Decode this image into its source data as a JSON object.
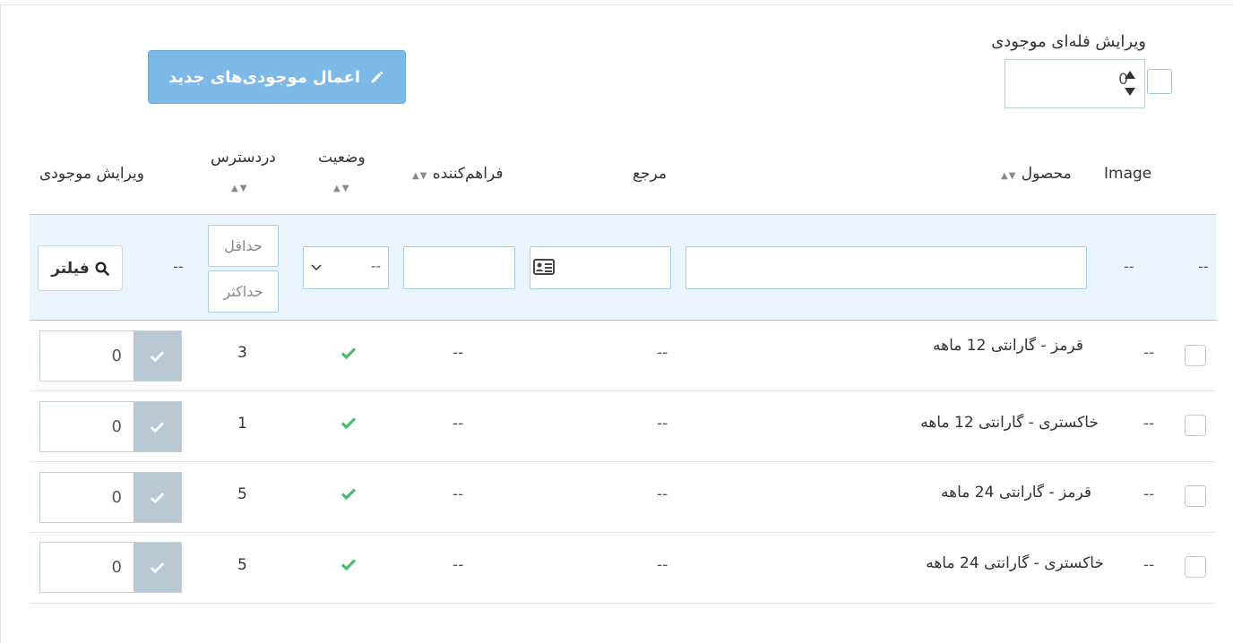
{
  "bulk": {
    "label": "ویرایش فله‌ای موجودی",
    "value": "0",
    "apply_label": "اعمال موجودی‌های جدید"
  },
  "columns": {
    "image": "Image",
    "product": "محصول",
    "reference": "مرجع",
    "supplier": "فراهم‌کننده",
    "status": "وضعیت",
    "available": "دردسترس",
    "edit_quantity": "ویرایش موجودی",
    "sort_arrows": "▲▼"
  },
  "filters": {
    "empty": "--",
    "status_select": "--",
    "min_placeholder": "حداقل",
    "max_placeholder": "حداکثر",
    "filter_button": "فیلتر"
  },
  "rows": [
    {
      "image": "--",
      "product": "قرمز - گارانتی 12 ماهه",
      "reference": "--",
      "supplier": "--",
      "available": "3",
      "edit_value": "0"
    },
    {
      "image": "--",
      "product": "خاکستری - گارانتی 12 ماهه",
      "reference": "--",
      "supplier": "--",
      "available": "1",
      "edit_value": "0"
    },
    {
      "image": "--",
      "product": "قرمز - گارانتی 24 ماهه",
      "reference": "--",
      "supplier": "--",
      "available": "5",
      "edit_value": "0"
    },
    {
      "image": "--",
      "product": "خاکستری - گارانتی 24 ماهه",
      "reference": "--",
      "supplier": "--",
      "available": "5",
      "edit_value": "0"
    }
  ],
  "colors": {
    "apply_button": "#7cb9e6",
    "filter_row": "#eaf4fb",
    "status_ok": "#4cbb6c",
    "qty_button": "#b8c9d3"
  }
}
